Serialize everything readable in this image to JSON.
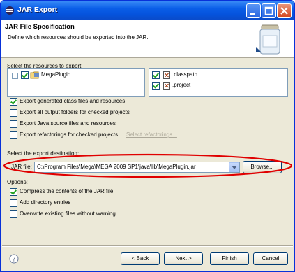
{
  "window": {
    "title": "JAR Export"
  },
  "header": {
    "title": "JAR File Specification",
    "description": "Define which resources should be exported into the JAR."
  },
  "resources": {
    "label": "Select the resources to export:",
    "tree_items": [
      {
        "label": "MegaPlugin"
      }
    ],
    "files": [
      {
        "label": ".classpath"
      },
      {
        "label": ".project"
      }
    ]
  },
  "export_options": [
    {
      "label": "Export generated class files and resources",
      "checked": true
    },
    {
      "label": "Export all output folders for checked projects",
      "checked": false
    },
    {
      "label": "Export Java source files and resources",
      "checked": false
    },
    {
      "label": "Export refactorings for checked projects.",
      "checked": false
    }
  ],
  "select_refactorings": "Select refactorings...",
  "destination": {
    "label": "Select the export destination:",
    "jar_label": "JAR file:",
    "jar_value": "C:\\Program Files\\Mega\\MEGA 2009 SP1\\java\\lib\\MegaPlugin.jar",
    "browse": "Browse..."
  },
  "options": {
    "label": "Options:",
    "items": [
      {
        "label": "Compress the contents of the JAR file",
        "checked": true
      },
      {
        "label": "Add directory entries",
        "checked": false
      },
      {
        "label": "Overwrite existing files without warning",
        "checked": false
      }
    ]
  },
  "buttons": {
    "back": "< Back",
    "next": "Next >",
    "finish": "Finish",
    "cancel": "Cancel"
  },
  "colors": {
    "highlight": "#e00000",
    "title_bar": "#0553dc"
  }
}
